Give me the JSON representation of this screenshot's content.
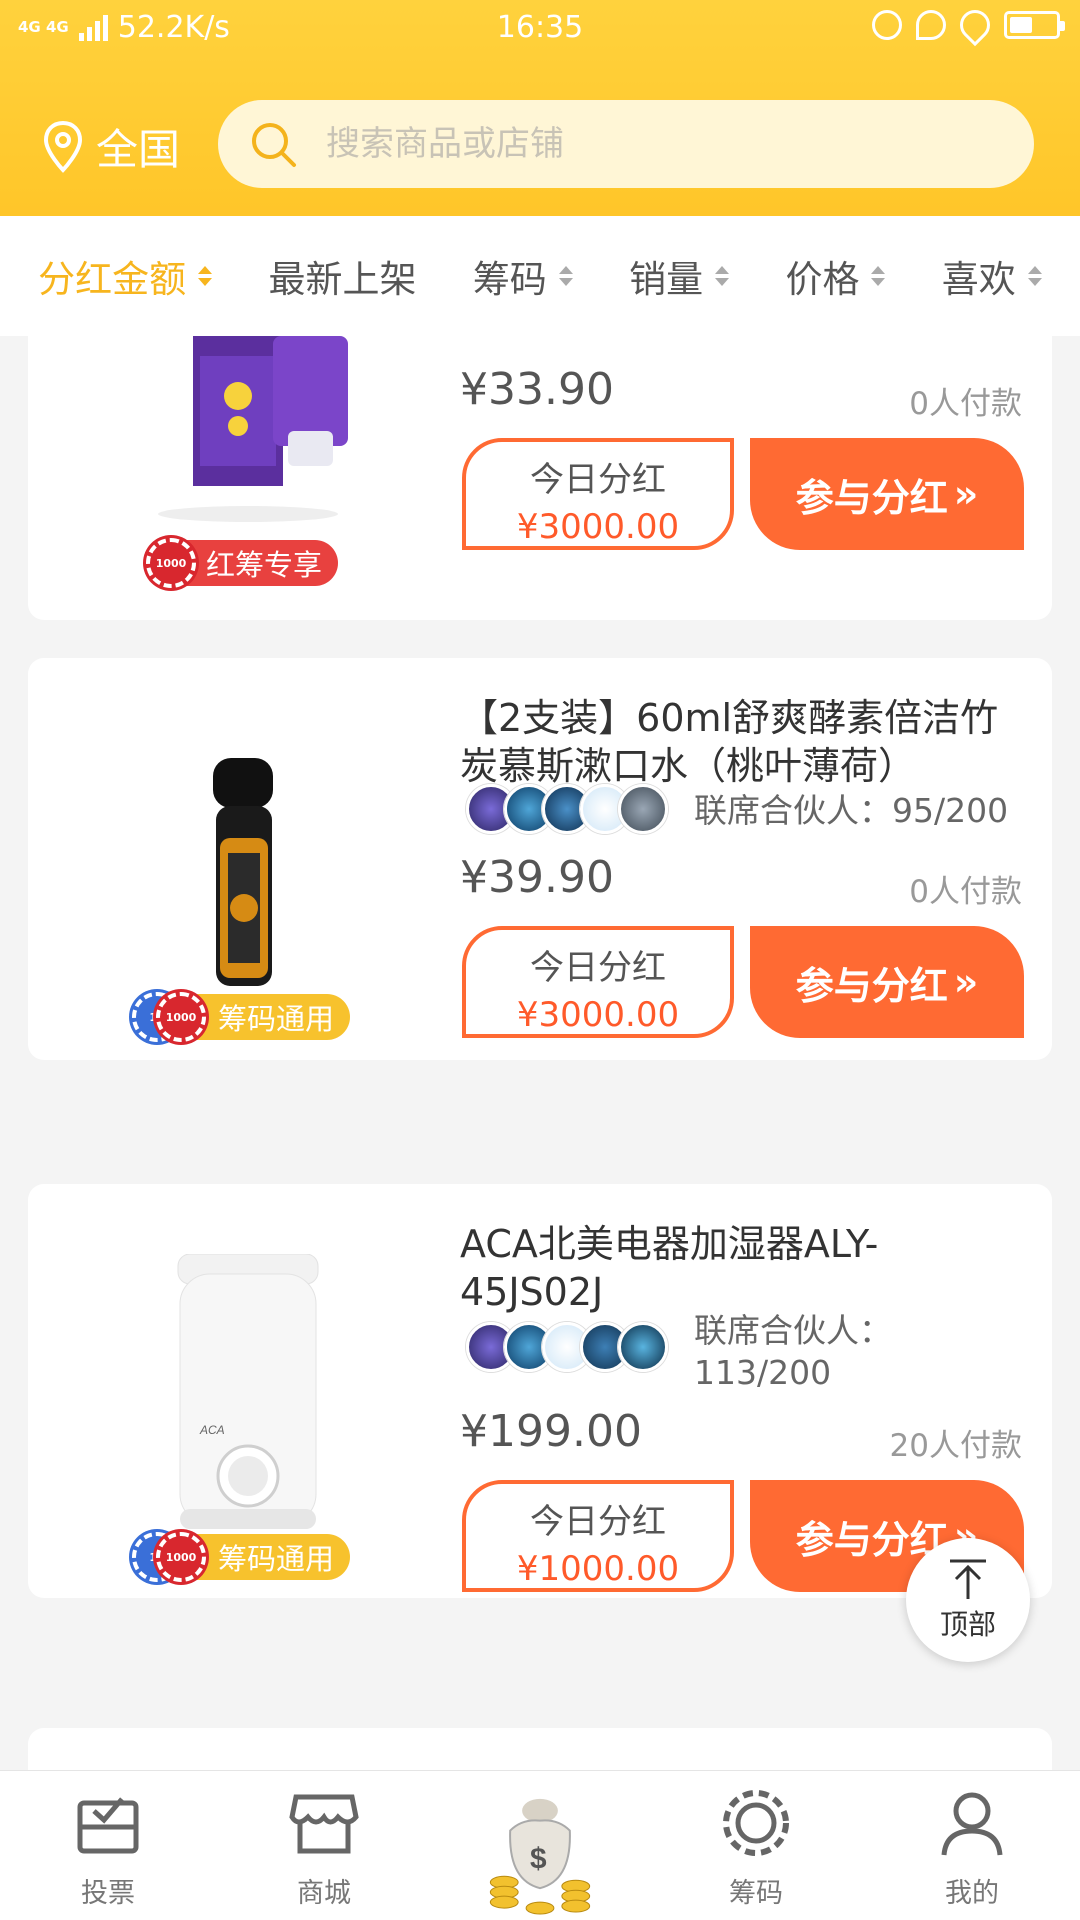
{
  "status": {
    "network": "4G 4G",
    "speed": "52.2K/s",
    "time": "16:35"
  },
  "header": {
    "location": "全国",
    "search_placeholder": "搜索商品或店铺"
  },
  "sort": [
    {
      "label": "分红金额",
      "active": true,
      "arrows": true
    },
    {
      "label": "最新上架",
      "active": false,
      "arrows": false
    },
    {
      "label": "筹码",
      "active": false,
      "arrows": true
    },
    {
      "label": "销量",
      "active": false,
      "arrows": true
    },
    {
      "label": "价格",
      "active": false,
      "arrows": true
    },
    {
      "label": "喜欢",
      "active": false,
      "arrows": true
    }
  ],
  "products": [
    {
      "price": "¥33.90",
      "paid": "0人付款",
      "bonus_label": "今日分红",
      "bonus_amount": "¥3000.00",
      "join_label": "参与分红",
      "tag": "红筹专享",
      "chip": "1000"
    },
    {
      "title": "【2支装】60ml舒爽酵素倍洁竹炭慕斯漱口水（桃叶薄荷）",
      "partners": "联席合伙人：95/200",
      "price": "¥39.90",
      "paid": "0人付款",
      "bonus_label": "今日分红",
      "bonus_amount": "¥3000.00",
      "join_label": "参与分红",
      "tag": "筹码通用",
      "chip": "1000",
      "chip_small": "10"
    },
    {
      "title": "ACA北美电器加湿器ALY-45JS02J",
      "brand": "ACA",
      "partners": "联席合伙人：113/200",
      "price": "¥199.00",
      "paid": "20人付款",
      "bonus_label": "今日分红",
      "bonus_amount": "¥1000.00",
      "join_label": "参与分红",
      "tag": "筹码通用",
      "chip": "1000",
      "chip_small": "10"
    }
  ],
  "top_button": "顶部",
  "nav": [
    {
      "label": "投票",
      "icon": "vote-icon"
    },
    {
      "label": "商城",
      "icon": "store-icon"
    },
    {
      "label": "",
      "icon": "money-bag-icon"
    },
    {
      "label": "筹码",
      "icon": "chip-icon"
    },
    {
      "label": "我的",
      "icon": "user-icon"
    }
  ],
  "colors": {
    "header": "#ffc629",
    "accent": "#f7b51e",
    "button": "#ff6a33",
    "price_red": "#ff5a2a"
  }
}
